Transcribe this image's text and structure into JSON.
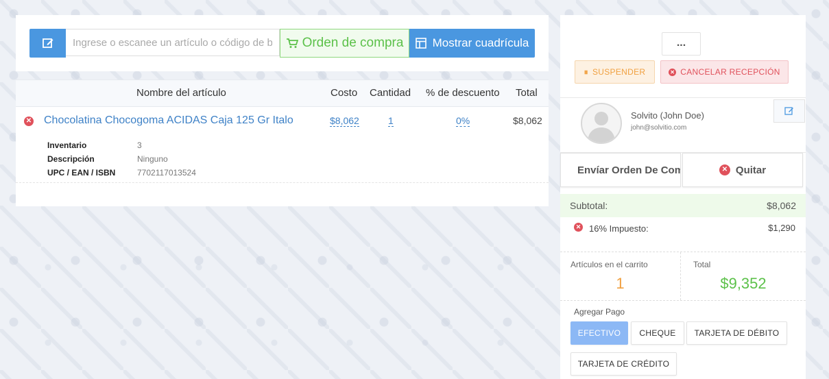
{
  "search": {
    "placeholder": "Ingrese o escanee un artículo o código de barras",
    "purchase_order_label": "Orden de compra",
    "show_grid_label": "Mostrar cuadrícula"
  },
  "cart": {
    "columns": {
      "name": "Nombre del artículo",
      "cost": "Costo",
      "qty": "Cantidad",
      "discount": "% de descuento",
      "total": "Total"
    },
    "item": {
      "name": "Chocolatina Chocogoma ACIDAS Caja 125 Gr Italo",
      "cost": "$8,062",
      "qty": "1",
      "discount": "0%",
      "total": "$8,062",
      "details": [
        {
          "label": "Inventario",
          "value": "3"
        },
        {
          "label": "Descripción",
          "value": "Ninguno"
        },
        {
          "label": "UPC / EAN / ISBN",
          "value": "7702117013524"
        }
      ]
    }
  },
  "sidebar": {
    "more_label": "...",
    "suspend_label": "SUSPENDER",
    "cancel_label": "CANCELAR RECEPCIÓN",
    "customer": {
      "name": "Solvito (John Doe)",
      "email": "john@solvitio.com"
    },
    "send_po_label": "Envíar Orden De Compra",
    "remove_label": "Quitar",
    "subtotal_label": "Subtotal:",
    "subtotal_value": "$8,062",
    "tax_label": "16% Impuesto:",
    "tax_value": "$1,290",
    "items_in_cart_label": "Artículos en el carrito",
    "items_in_cart_value": "1",
    "total_label": "Total",
    "total_value": "$9,352",
    "add_payment_label": "Agregar Pago",
    "payment_methods": [
      "EFECTIVO",
      "CHEQUE",
      "TARJETA DE DÉBITO",
      "TARJETA DE CRÉDITO"
    ]
  },
  "colors": {
    "primary": "#4a97e0",
    "success": "#5cc14a",
    "warning": "#f0a040",
    "danger": "#e0515b",
    "orange_count": "#f0a040"
  }
}
